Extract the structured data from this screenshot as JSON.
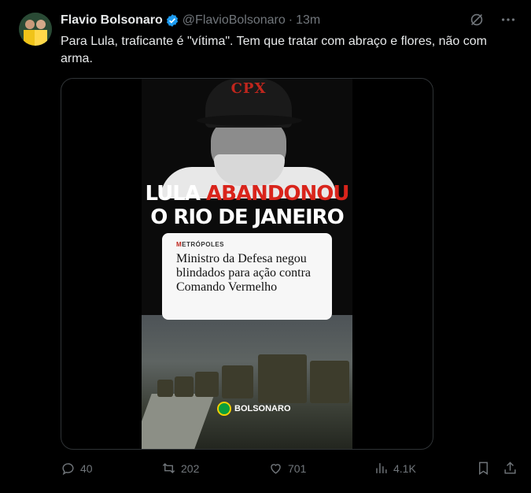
{
  "tweet": {
    "display_name": "Flavio Bolsonaro",
    "handle": "@FlavioBolsonaro",
    "separator": "·",
    "time": "13m",
    "text": "Para Lula, traficante é \"vítima\". Tem que tratar com abraço e flores, não com arma."
  },
  "media": {
    "cap_text": "CPX",
    "headline_plain": "LULA ",
    "headline_red": "ABANDONOU",
    "headline_line2": "O RIO DE JANEIRO",
    "card_brand": "METRÓPOLES",
    "card_title": "Ministro da Defesa negou blindados para ação contra Comando Vermelho",
    "watermark": "BOLSONARO"
  },
  "actions": {
    "replies": "40",
    "reposts": "202",
    "likes": "701",
    "views": "4.1K"
  },
  "colors": {
    "background": "#000000",
    "text": "#e7e9ea",
    "muted": "#71767b",
    "verified": "#1d9bf0",
    "headline_red": "#d9241b"
  },
  "icons": [
    "verified-badge-icon",
    "grok-icon",
    "more-icon",
    "reply-icon",
    "repost-icon",
    "like-icon",
    "views-icon",
    "bookmark-icon",
    "share-icon"
  ]
}
